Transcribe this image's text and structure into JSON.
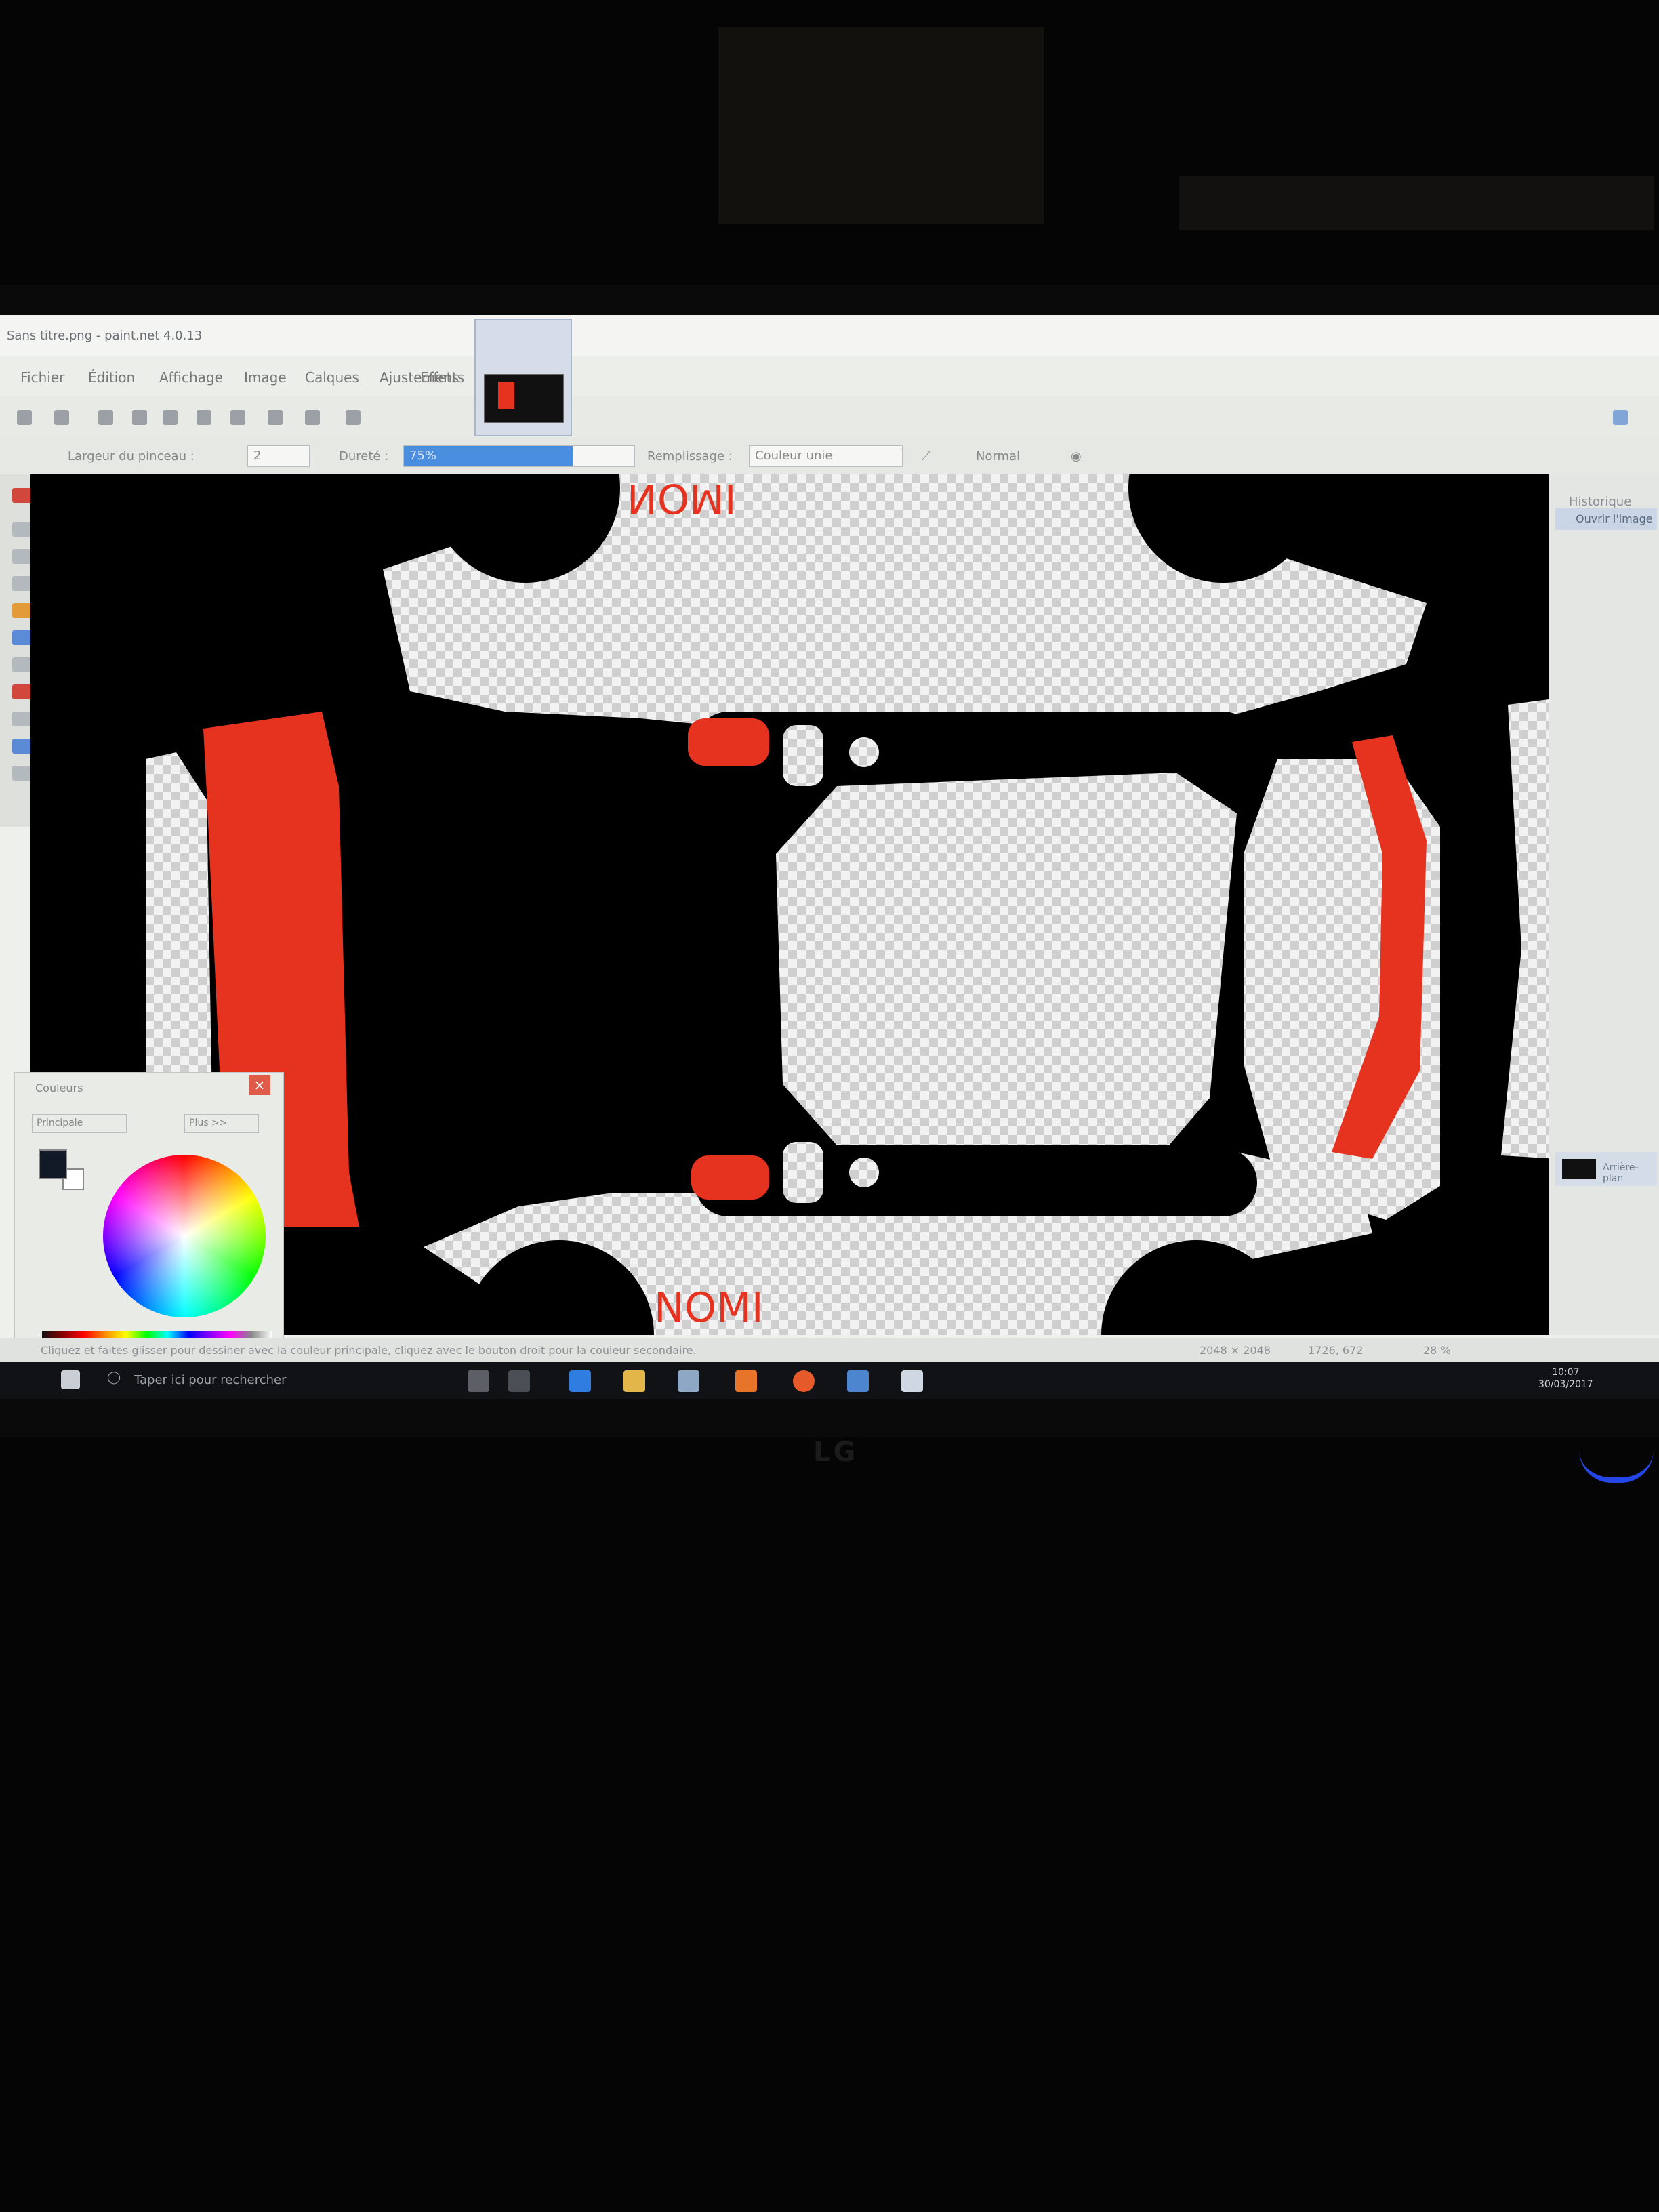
{
  "window": {
    "title": "Sans titre.png - paint.net 4.0.13"
  },
  "menu": {
    "items": [
      "Fichier",
      "Édition",
      "Affichage",
      "Image",
      "Calques",
      "Ajustements",
      "Effets"
    ]
  },
  "options_bar": {
    "brush_label": "Largeur du pinceau :",
    "brush_value": "2",
    "hardness_label": "Dureté :",
    "hardness_value": "75%",
    "fill_label": "Remplissage :",
    "fill_value": "Couleur unie",
    "blend_label": "Normal"
  },
  "canvas": {
    "label_top": "NOMI",
    "label_bottom": "NOMI",
    "colors": {
      "background": "#000000",
      "transparent_a": "#f2f2f2",
      "transparent_b": "#cfcfcf",
      "red": "#e63320"
    }
  },
  "layers_panel": {
    "title": "Historique",
    "item": "Ouvrir l'image",
    "layer_name": "Arrière-plan"
  },
  "colors_panel": {
    "title": "Couleurs",
    "primary_button": "Principale",
    "more_button": "Plus >>"
  },
  "status": {
    "hint": "Cliquez et faites glisser pour dessiner avec la couleur principale, cliquez avec le bouton droit pour la couleur secondaire.",
    "size": "2048 × 2048",
    "coords": "1726, 672",
    "zoom": "28 %"
  },
  "taskbar": {
    "search_placeholder": "Taper ici pour rechercher",
    "time": "10:07",
    "date": "30/03/2017"
  },
  "monitor": {
    "brand": "LG"
  }
}
